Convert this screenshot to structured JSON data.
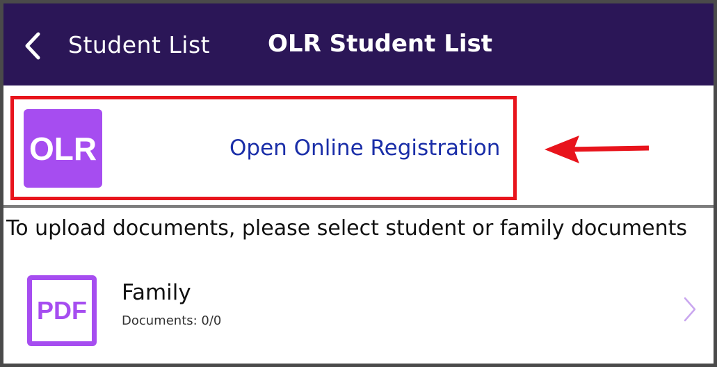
{
  "header": {
    "back_label": "Student List",
    "title": "OLR Student List",
    "background": "#2b1657"
  },
  "olr": {
    "badge_text": "OLR",
    "link_text": "Open Online Registration",
    "badge_color": "#a64df0",
    "highlight_color": "#e8141c"
  },
  "instruction": "To upload documents, please select student or family documents",
  "family": {
    "icon_text": "PDF",
    "title": "Family",
    "subtitle": "Documents: 0/0"
  }
}
